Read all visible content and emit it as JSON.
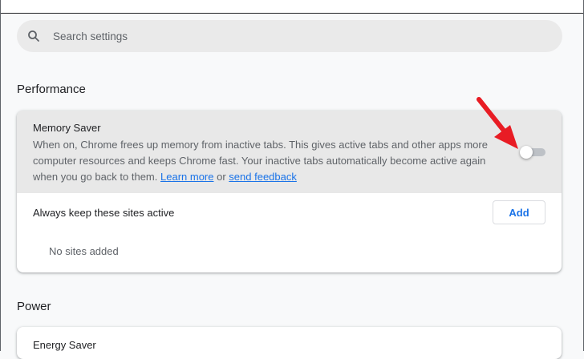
{
  "search": {
    "placeholder": "Search settings",
    "icon": "search-icon"
  },
  "performance": {
    "section_title": "Performance",
    "memory_saver": {
      "title": "Memory Saver",
      "description": "When on, Chrome frees up memory from inactive tabs. This gives active tabs and other apps more computer resources and keeps Chrome fast. Your inactive tabs automatically become active again when you go back to them.",
      "learn_more_label": "Learn more",
      "connector": "or",
      "feedback_label": "send feedback",
      "enabled": false
    },
    "always_active": {
      "title": "Always keep these sites active",
      "add_label": "Add",
      "empty_label": "No sites added"
    }
  },
  "power": {
    "section_title": "Power",
    "energy_saver": {
      "title": "Energy Saver"
    }
  },
  "colors": {
    "accent": "#1a73e8",
    "arrow": "#e81c24",
    "highlight": "#e8e8e8"
  }
}
